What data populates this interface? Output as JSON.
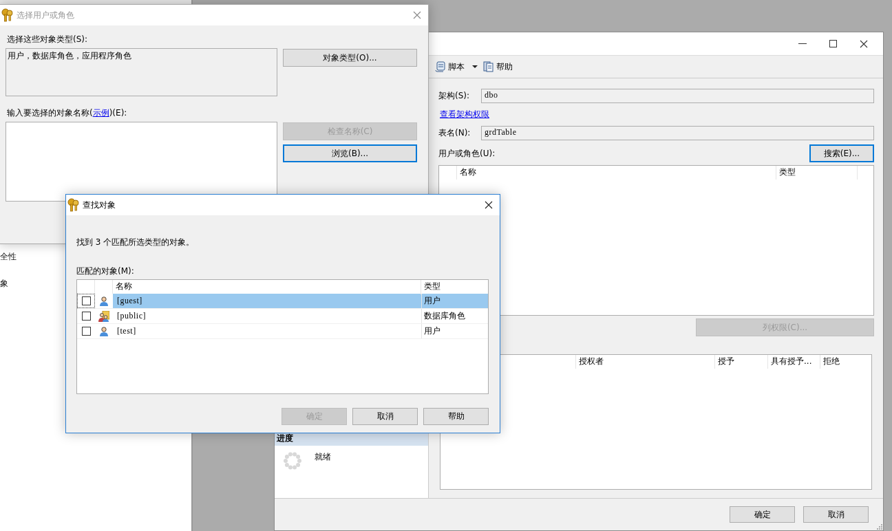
{
  "background_window": {
    "items": [
      "全性",
      "象"
    ]
  },
  "properties_window": {
    "toolbar": [
      {
        "kind": "script",
        "label": "脚本",
        "dropdown": true
      },
      {
        "kind": "help",
        "label": "帮助",
        "dropdown": false
      }
    ],
    "schema": {
      "label": "架构(S):",
      "value": "dbo"
    },
    "schema_link": "查看架构权限",
    "table_name": {
      "label": "表名(N):",
      "value": "grdTable"
    },
    "users_label": "用户或角色(U):",
    "search_button": {
      "label": "搜索(E)...",
      "disabled": false,
      "focused": true
    },
    "users_table": {
      "columns": [
        "名称",
        "类型"
      ]
    },
    "column_permissions_button": {
      "label": "列权限(C)...",
      "disabled": true,
      "focused": false
    },
    "permissions_table": {
      "columns": [
        "授权者",
        "授予",
        "具有授予...",
        "拒绝"
      ]
    },
    "progress": {
      "title": "进度",
      "status": "就绪"
    },
    "buttons": [
      {
        "label": "确定",
        "disabled": false,
        "focused": false
      },
      {
        "label": "取消",
        "disabled": false,
        "focused": false
      }
    ]
  },
  "select_dialog": {
    "title": "选择用户或角色",
    "active": false,
    "types_label": "选择这些对象类型(S):",
    "types_value": "用户，数据库角色，应用程序角色",
    "types_button": {
      "label": "对象类型(O)...",
      "disabled": false,
      "focused": false
    },
    "names_label": {
      "before": "输入要选择的对象名称(",
      "link": "示例",
      "after": ")(E):"
    },
    "check_button": {
      "label": "检查名称(C)",
      "disabled": true,
      "focused": false
    },
    "browse_button": {
      "label": "浏览(B)...",
      "disabled": false,
      "focused": true
    }
  },
  "find_dialog": {
    "title": "查找对象",
    "active": true,
    "message": "找到 3 个匹配所选类型的对象。",
    "list_label": "匹配的对象(M):",
    "columns": [
      "名称",
      "类型"
    ],
    "rows": [
      {
        "kind": "user",
        "name": "[guest]",
        "type": "用户",
        "checked": false,
        "selected": true
      },
      {
        "kind": "role",
        "name": "[public]",
        "type": "数据库角色",
        "checked": false,
        "selected": false
      },
      {
        "kind": "user",
        "name": "[test]",
        "type": "用户",
        "checked": false,
        "selected": false
      }
    ],
    "buttons": [
      {
        "label": "确定",
        "disabled": true,
        "focused": false
      },
      {
        "label": "取消",
        "disabled": false,
        "focused": false
      },
      {
        "label": "帮助",
        "disabled": false,
        "focused": false
      }
    ]
  }
}
